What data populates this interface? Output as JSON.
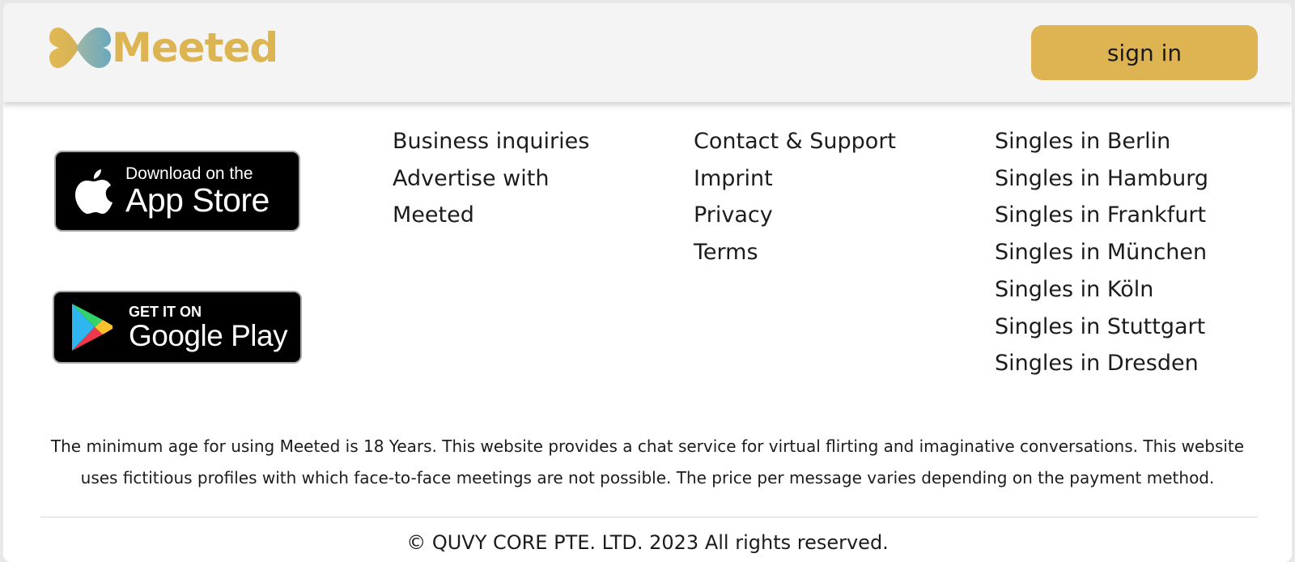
{
  "header": {
    "logo_text": "Meeted",
    "signin_label": "sign in"
  },
  "colors": {
    "brand_gold": "#ddb451",
    "logo_teal": "#6ea9b8",
    "header_bg": "#f4f4f4"
  },
  "badges": {
    "app_store": {
      "small": "Download on the",
      "big": "App Store",
      "icon": "apple-icon"
    },
    "google_play": {
      "small": "GET IT ON",
      "big": "Google Play",
      "icon": "google-play-icon"
    }
  },
  "footer": {
    "col1": [
      "Business inquiries",
      "Advertise with",
      "Meeted"
    ],
    "col2": [
      "Contact & Support",
      "Imprint",
      "Privacy",
      "Terms"
    ],
    "col3": [
      "Singles in Berlin",
      "Singles in Hamburg",
      "Singles in Frankfurt",
      "Singles in München",
      "Singles in Köln",
      "Singles in Stuttgart",
      "Singles in Dresden"
    ],
    "disclaimer_line1": "The minimum age for using Meeted is 18 Years. This website provides a chat service for virtual flirting and imaginative conversations. This website",
    "disclaimer_line2": "uses fictitious profiles with which face-to-face meetings are not possible. The price per message varies depending on the payment method.",
    "copyright": "© QUVY CORE PTE. LTD. 2023 All rights reserved."
  }
}
